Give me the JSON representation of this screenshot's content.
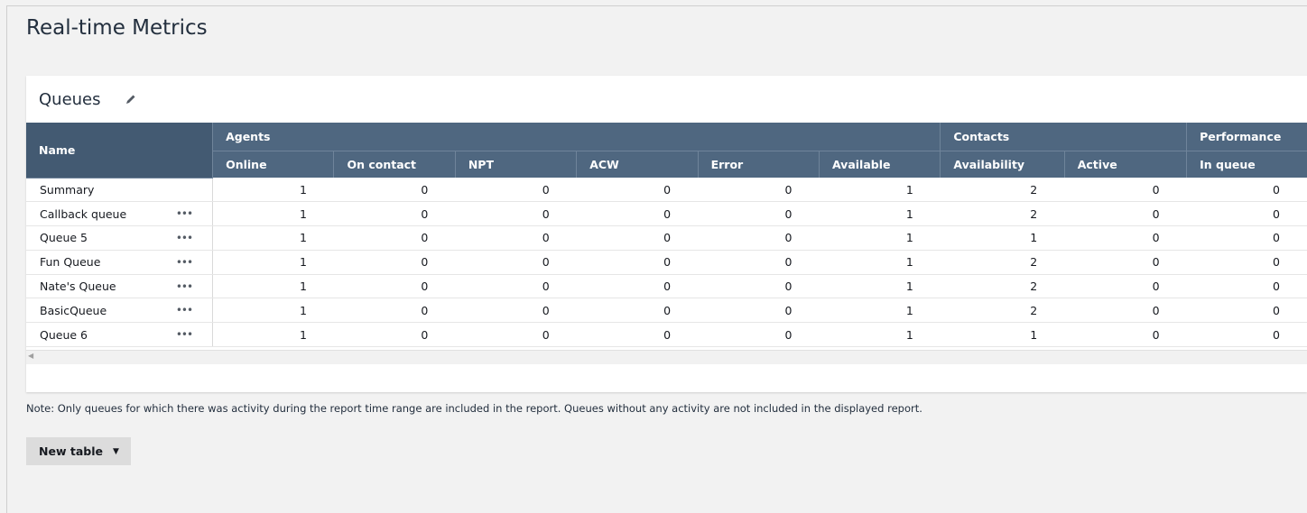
{
  "page": {
    "title": "Real-time Metrics"
  },
  "panel": {
    "title": "Queues",
    "edit_icon": "pencil-icon"
  },
  "table": {
    "name_header": "Name",
    "groups": [
      {
        "label": "Agents"
      },
      {
        "label": "Contacts"
      },
      {
        "label": "Performance"
      }
    ],
    "columns": [
      "Online",
      "On contact",
      "NPT",
      "ACW",
      "Error",
      "Available",
      "Availability",
      "Active",
      "In queue"
    ],
    "rows": [
      {
        "name": "Summary",
        "has_menu": false,
        "values": [
          "1",
          "0",
          "0",
          "0",
          "0",
          "1",
          "2",
          "0",
          "0"
        ]
      },
      {
        "name": "Callback queue",
        "has_menu": true,
        "values": [
          "1",
          "0",
          "0",
          "0",
          "0",
          "1",
          "2",
          "0",
          "0"
        ]
      },
      {
        "name": "Queue 5",
        "has_menu": true,
        "values": [
          "1",
          "0",
          "0",
          "0",
          "0",
          "1",
          "1",
          "0",
          "0"
        ]
      },
      {
        "name": "Fun Queue",
        "has_menu": true,
        "values": [
          "1",
          "0",
          "0",
          "0",
          "0",
          "1",
          "2",
          "0",
          "0"
        ]
      },
      {
        "name": "Nate's Queue",
        "has_menu": true,
        "values": [
          "1",
          "0",
          "0",
          "0",
          "0",
          "1",
          "2",
          "0",
          "0"
        ]
      },
      {
        "name": "BasicQueue",
        "has_menu": true,
        "values": [
          "1",
          "0",
          "0",
          "0",
          "0",
          "1",
          "2",
          "0",
          "0"
        ]
      },
      {
        "name": "Queue 6",
        "has_menu": true,
        "values": [
          "1",
          "0",
          "0",
          "0",
          "0",
          "1",
          "1",
          "0",
          "0"
        ]
      }
    ],
    "row_menu_glyph": "•••"
  },
  "note": "Note: Only queues for which there was activity during the report time range are included in the report. Queues without any activity are not included in the displayed report.",
  "new_table_button": {
    "label": "New table",
    "icon": "caret-down-icon"
  },
  "colors": {
    "header_bg": "#4f6780",
    "name_header_bg": "#435a72",
    "page_bg": "#f2f2f2"
  }
}
